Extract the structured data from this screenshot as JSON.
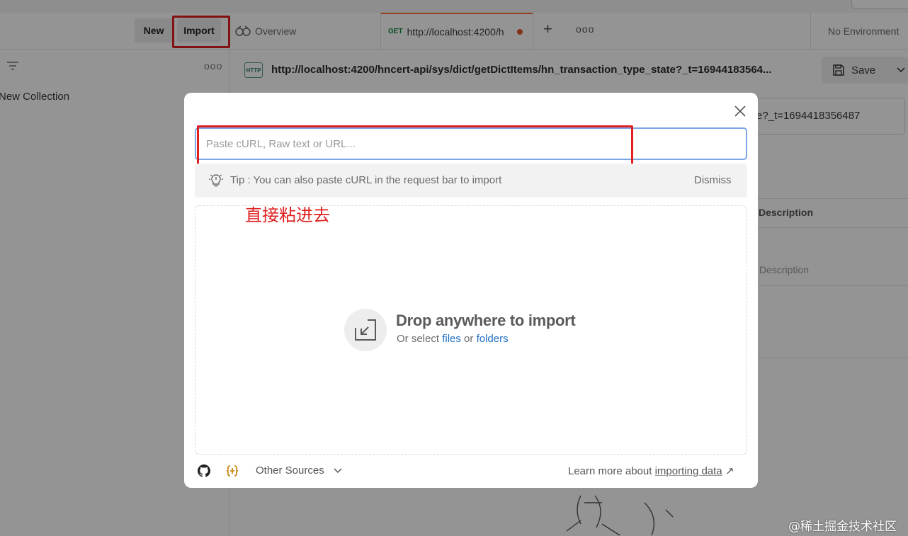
{
  "toolbar": {
    "new_label": "New",
    "import_label": "Import"
  },
  "tabs": {
    "overview_label": "Overview",
    "request": {
      "method": "GET",
      "label": "http://localhost:4200/h"
    }
  },
  "environment": {
    "label": "No Environment"
  },
  "sidebar": {
    "collection_name": "New Collection"
  },
  "request": {
    "url": "http://localhost:4200/hncert-api/sys/dict/getDictItems/hn_transaction_type_state?_t=16944183564...",
    "url_input_tail": "e?_t=1694418356487",
    "save_label": "Save",
    "http_badge": "HTTP"
  },
  "params_table": {
    "header_description": "Description",
    "placeholder_description": "Description"
  },
  "import_modal": {
    "input_placeholder": "Paste cURL, Raw text or URL...",
    "tip": "Tip : You can also paste cURL in the request bar to import",
    "dismiss_label": "Dismiss",
    "annotation": "直接粘进去",
    "drop_title": "Drop anywhere to import",
    "drop_sub_prefix": "Or select",
    "files_link": "files",
    "or_word": "or",
    "folders_link": "folders",
    "other_sources_label": "Other Sources",
    "learn_more_prefix": "Learn more about",
    "learn_more_link": "importing data",
    "learn_more_arrow": "↗"
  },
  "watermark": "@稀土掘金技术社区",
  "colors": {
    "accent_orange": "#ff6c37",
    "highlight_red": "#e02020",
    "link_blue": "#1f6fc5",
    "input_focus": "#7aa6e6"
  },
  "icons": [
    "filter-icon",
    "more-icon",
    "overview-icon",
    "plus-icon",
    "save-icon",
    "chevron-down-icon",
    "close-icon",
    "lightbulb-icon",
    "import-arrow-icon",
    "github-icon",
    "swagger-icon",
    "external-link-icon"
  ]
}
